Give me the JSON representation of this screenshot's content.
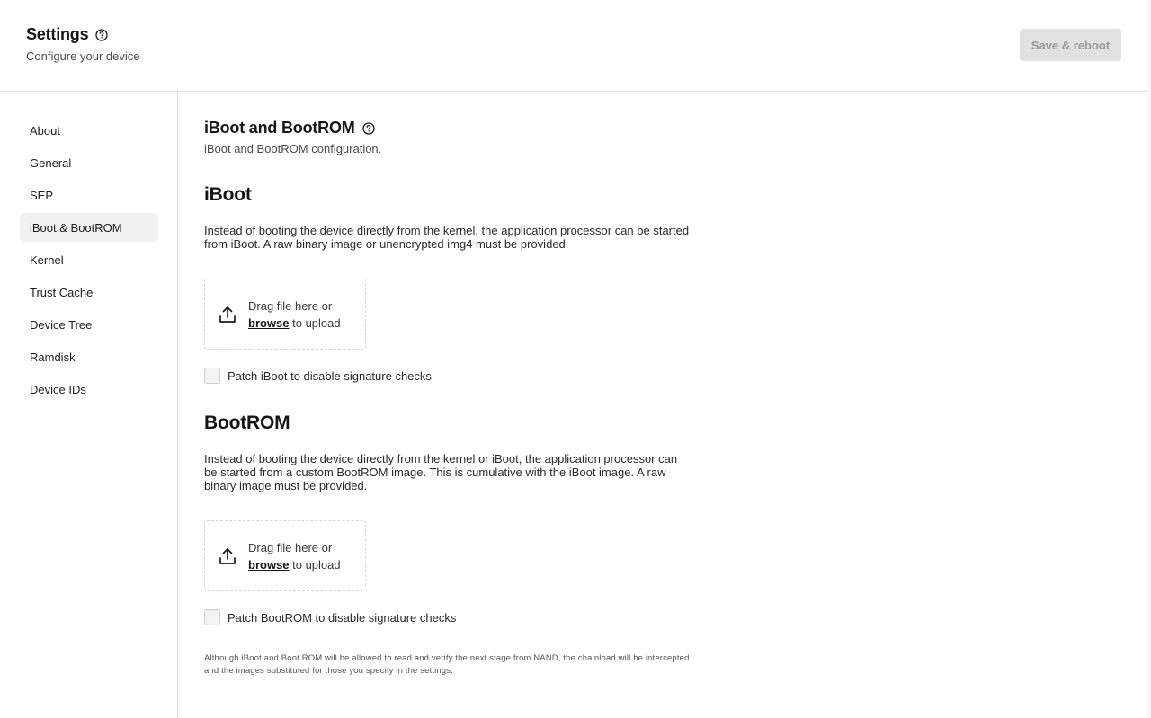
{
  "header": {
    "title": "Settings",
    "subtitle": "Configure your device",
    "help_icon": "help-circle-icon",
    "save_button": {
      "label": "Save & reboot",
      "disabled": true
    }
  },
  "sidebar": {
    "items": [
      {
        "label": "About",
        "active": false
      },
      {
        "label": "General",
        "active": false
      },
      {
        "label": "SEP",
        "active": false
      },
      {
        "label": "iBoot & BootROM",
        "active": true
      },
      {
        "label": "Kernel",
        "active": false
      },
      {
        "label": "Trust Cache",
        "active": false
      },
      {
        "label": "Device Tree",
        "active": false
      },
      {
        "label": "Ramdisk",
        "active": false
      },
      {
        "label": "Device IDs",
        "active": false
      }
    ]
  },
  "main": {
    "title": "iBoot and BootROM",
    "subtitle": "iBoot and BootROM configuration.",
    "sections": [
      {
        "title": "iBoot",
        "description": "Instead of booting the device directly from the kernel, the application processor can be started from iBoot. A raw binary image or unencrypted img4 must be provided.",
        "dropzone": {
          "line1": "Drag file here or",
          "browse": "browse",
          "line2_suffix": " to upload"
        },
        "checkbox": {
          "label": "Patch iBoot to disable signature checks",
          "checked": false
        }
      },
      {
        "title": "BootROM",
        "description": "Instead of booting the device directly from the kernel or iBoot, the application processor can be started from a custom BootROM image. This is cumulative with the iBoot image. A raw binary image must be provided.",
        "dropzone": {
          "line1": "Drag file here or",
          "browse": "browse",
          "line2_suffix": " to upload"
        },
        "checkbox": {
          "label": "Patch BootROM to disable signature checks",
          "checked": false
        }
      }
    ],
    "footnote": "Although iBoot and Boot ROM will be allowed to read and verify the next stage from NAND, the chainload will be intercepted and the images substituted for those you specify in the settings."
  },
  "colors": {
    "active_nav_bg": "#f1f1f1",
    "disabled_button_bg": "#e1e1e1",
    "disabled_button_text": "#9a9a9a",
    "divider": "#e2e2e2"
  }
}
